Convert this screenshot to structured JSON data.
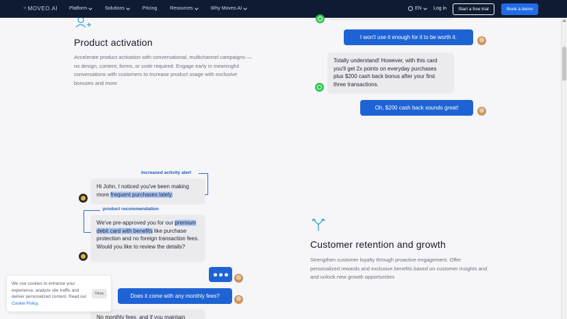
{
  "nav": {
    "logo": "MOVEO.AI",
    "menu": [
      {
        "label": "Platform",
        "has_dropdown": true
      },
      {
        "label": "Solutions",
        "has_dropdown": true
      },
      {
        "label": "Pricing",
        "has_dropdown": false
      },
      {
        "label": "Resources",
        "has_dropdown": true
      },
      {
        "label": "Why Moveo.AI",
        "has_dropdown": true
      }
    ],
    "language": "EN",
    "login": "Log in",
    "trial_button": "Start a free trial",
    "demo_button": "Book a demo"
  },
  "activation": {
    "icon": "user-plus-icon",
    "title": "Product activation",
    "description": "Accelerate product activation with conversational, multichannel campaigns —no design, content, forms, or code required. Engage early in meaningful conversations with customers to increase product usage with exclusive bonuses and more"
  },
  "chat_top": {
    "msg1": "I won't use it enough for it to be worth it.",
    "msg2": "Totally understand! However, with this card you'll get 2x points on everyday purchases plus $200 cash back bonus after your first three transactions.",
    "msg3": "Oh, $200 cash back sounds great!"
  },
  "chat_bottom": {
    "tag1": "increased activity alert",
    "msg1_pre": "Hi John, I noticed you've been making more ",
    "msg1_hl": "frequent purchases lately.",
    "tag2": "product recommendation",
    "msg2_pre": "We've pre-approved you for our ",
    "msg2_hl": "premium debit card with benefits",
    "msg2_post": " like purchase protection and no foreign transaction fees. Would you like to review the details?",
    "msg3": "Does it come with any monthly fees?",
    "msg4": "No monthly fees, and if you maintain"
  },
  "retention": {
    "icon": "split-arrows-icon",
    "title": "Customer retention and growth",
    "description": "Strengthen customer loyalty through proactive engagement. Offer personalized rewards and exclusive benefits based on customer insights and and unlock new growth opportunities"
  },
  "cookie": {
    "text": "We use cookies to enhance your experience, analyze site traffic and deliver personalized content. Read our ",
    "link": "Cookie Policy.",
    "button": "Okay"
  },
  "colors": {
    "nav_bg": "#0f1b33",
    "accent": "#1f6ce6",
    "bubble_blue": "#1e63d4",
    "highlight": "#a9c6f5"
  }
}
